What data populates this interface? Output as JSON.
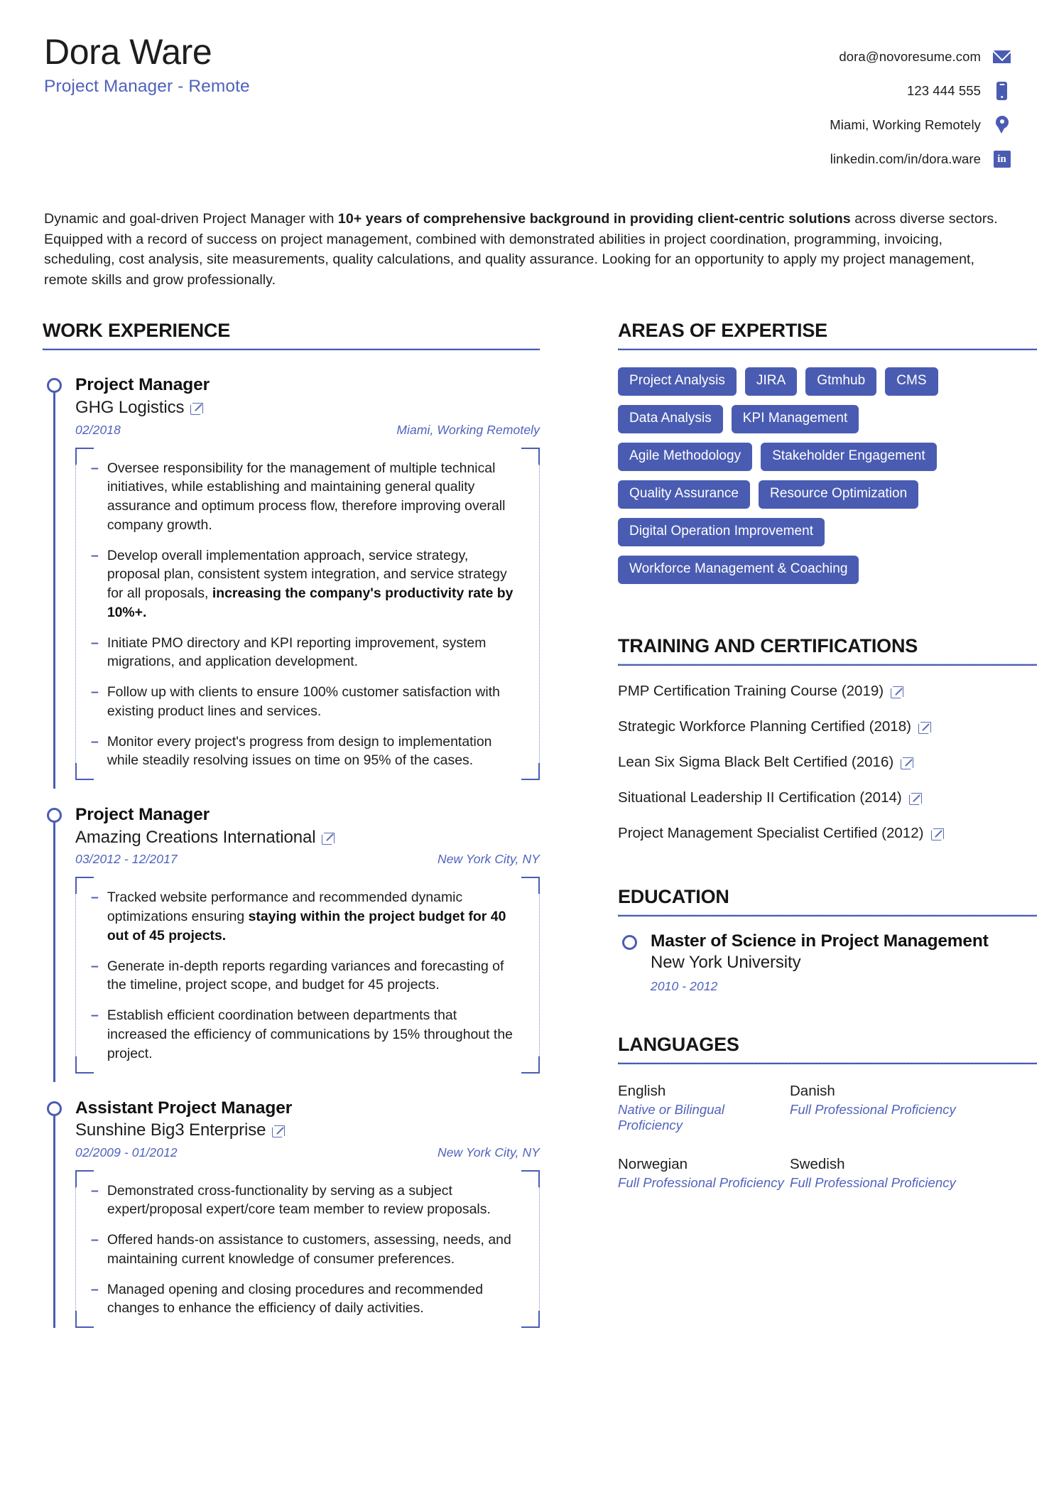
{
  "header": {
    "name": "Dora Ware",
    "title": "Project Manager - Remote",
    "contacts": [
      {
        "text": "dora@novoresume.com",
        "icon": "email-icon"
      },
      {
        "text": "123 444 555",
        "icon": "phone-icon"
      },
      {
        "text": "Miami, Working Remotely",
        "icon": "location-pin-icon"
      },
      {
        "text": "linkedin.com/in/dora.ware",
        "icon": "linkedin-icon",
        "glyph": "in"
      }
    ]
  },
  "summary": {
    "part1": "Dynamic and goal-driven Project Manager with ",
    "bold": "10+ years of comprehensive background in providing client-centric solutions",
    "part2": " across diverse sectors. Equipped with a record of success on project management, combined with demonstrated abilities in project coordination, programming, invoicing, scheduling, cost analysis, site measurements, quality calculations, and quality assurance. Looking for an opportunity to apply my project management, remote skills and grow professionally."
  },
  "sections": {
    "work_experience": "WORK EXPERIENCE",
    "areas_of_expertise": "AREAS OF EXPERTISE",
    "training_and_certifications": "TRAINING AND CERTIFICATIONS",
    "education": "EDUCATION",
    "languages": "LANGUAGES"
  },
  "work_experience": [
    {
      "job_title": "Project Manager",
      "company": "GHG Logistics",
      "dates": "02/2018",
      "location": "Miami, Working Remotely",
      "bullets": [
        {
          "text": "Oversee responsibility for the management of multiple technical initiatives, while establishing and maintaining general quality assurance and optimum process flow, therefore improving overall company growth."
        },
        {
          "text": "Develop overall implementation approach, service strategy, proposal plan, consistent system integration, and service strategy for all proposals, ",
          "bold": "increasing the company's productivity rate by 10%+."
        },
        {
          "text": "Initiate PMO directory and KPI reporting improvement, system migrations, and application development."
        },
        {
          "text": "Follow up with clients to ensure 100% customer satisfaction with existing product lines and services."
        },
        {
          "text": "Monitor every project's progress from design to implementation while steadily resolving issues on time on 95% of the cases."
        }
      ]
    },
    {
      "job_title": "Project Manager",
      "company": "Amazing Creations International",
      "dates": "03/2012 - 12/2017",
      "location": "New York City, NY",
      "bullets": [
        {
          "text": "Tracked website performance and recommended dynamic optimizations ensuring ",
          "bold": "staying within the project budget for 40 out of 45 projects."
        },
        {
          "text": "Generate in-depth reports regarding variances and forecasting of the timeline, project scope, and budget for 45 projects."
        },
        {
          "text": "Establish efficient coordination between departments that increased the efficiency of communications by 15% throughout the project."
        }
      ]
    },
    {
      "job_title": "Assistant Project Manager",
      "company": "Sunshine Big3 Enterprise",
      "dates": "02/2009 - 01/2012",
      "location": "New York City, NY",
      "bullets": [
        {
          "text": "Demonstrated cross-functionality by serving as a subject expert/proposal expert/core team member to review proposals."
        },
        {
          "text": "Offered hands-on assistance to customers, assessing, needs, and maintaining current knowledge of consumer preferences."
        },
        {
          "text": "Managed opening and closing procedures and recommended changes to enhance the efficiency of daily activities."
        }
      ]
    }
  ],
  "areas_of_expertise": [
    "Project Analysis",
    "JIRA",
    "Gtmhub",
    "CMS",
    "Data Analysis",
    "KPI Management",
    "Agile Methodology",
    "Stakeholder Engagement",
    "Quality Assurance",
    "Resource Optimization",
    "Digital Operation Improvement",
    "Workforce Management & Coaching"
  ],
  "training_and_certifications": [
    "PMP Certification Training Course (2019)",
    "Strategic Workforce Planning Certified (2018)",
    "Lean Six Sigma Black Belt Certified (2016)",
    "Situational Leadership II Certification (2014)",
    "Project Management Specialist Certified (2012)"
  ],
  "education": [
    {
      "degree": "Master of Science in Project Management",
      "school": "New York University",
      "dates": "2010 - 2012"
    }
  ],
  "languages": [
    {
      "name": "English",
      "level": "Native or Bilingual Proficiency"
    },
    {
      "name": "Danish",
      "level": "Full Professional Proficiency"
    },
    {
      "name": "Norwegian",
      "level": "Full Professional Proficiency"
    },
    {
      "name": "Swedish",
      "level": "Full Professional Proficiency"
    }
  ],
  "colors": {
    "accent": "#4a5cb2",
    "accent_text": "#4f62bd",
    "text": "#1d1d1d"
  }
}
